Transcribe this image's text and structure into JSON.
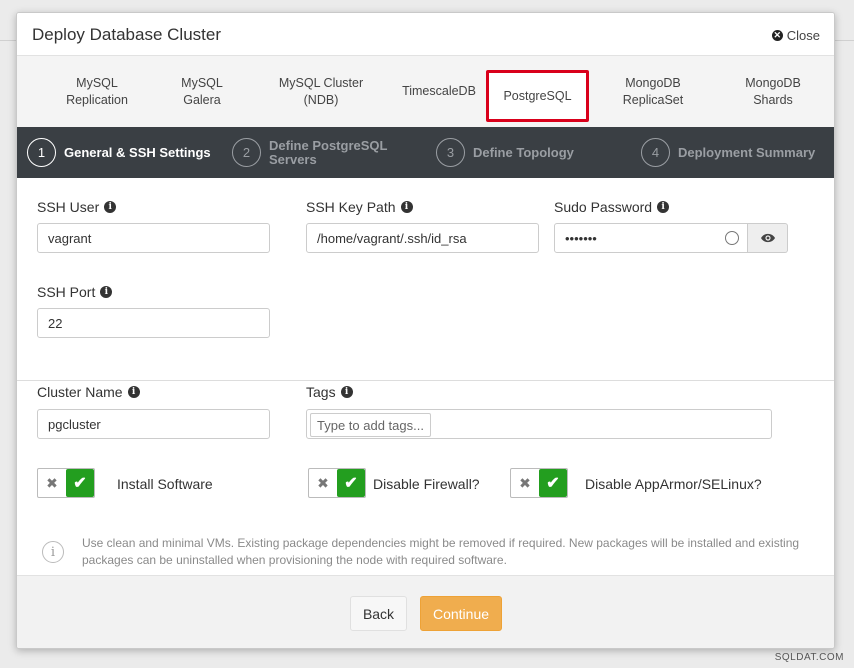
{
  "modal": {
    "title": "Deploy Database Cluster",
    "close_label": "Close"
  },
  "tabs": [
    {
      "line1": "MySQL",
      "line2": "Replication"
    },
    {
      "line1": "MySQL",
      "line2": "Galera"
    },
    {
      "line1": "MySQL Cluster",
      "line2": "(NDB)"
    },
    {
      "line1": "TimescaleDB",
      "line2": ""
    },
    {
      "line1": "PostgreSQL",
      "line2": ""
    },
    {
      "line1": "MongoDB",
      "line2": "ReplicaSet"
    },
    {
      "line1": "MongoDB",
      "line2": "Shards"
    }
  ],
  "active_tab": "PostgreSQL",
  "steps": [
    {
      "num": "1",
      "label1": "General & SSH Settings",
      "label2": ""
    },
    {
      "num": "2",
      "label1": "Define PostgreSQL",
      "label2": "Servers"
    },
    {
      "num": "3",
      "label1": "Define Topology",
      "label2": ""
    },
    {
      "num": "4",
      "label1": "Deployment Summary",
      "label2": ""
    }
  ],
  "form": {
    "ssh_user": {
      "label": "SSH User",
      "value": "vagrant"
    },
    "ssh_key_path": {
      "label": "SSH Key Path",
      "value": "/home/vagrant/.ssh/id_rsa"
    },
    "sudo_password": {
      "label": "Sudo Password",
      "value": "•••••••"
    },
    "ssh_port": {
      "label": "SSH Port",
      "value": "22"
    },
    "cluster_name": {
      "label": "Cluster Name",
      "value": "pgcluster"
    },
    "tags": {
      "label": "Tags",
      "placeholder": "Type to add tags..."
    }
  },
  "toggles": {
    "install_software": {
      "label": "Install Software",
      "on": true
    },
    "disable_firewall": {
      "label": "Disable Firewall?",
      "on": true
    },
    "disable_apparmor": {
      "label": "Disable AppArmor/SELinux?",
      "on": true
    }
  },
  "note": "Use clean and minimal VMs. Existing package dependencies might be removed if required. New packages will be installed and existing packages can be uninstalled when provisioning the node with required software.",
  "footer": {
    "back_label": "Back",
    "continue_label": "Continue"
  },
  "watermark": "SQLDAT.COM",
  "colors": {
    "accent_continue": "#f0ad4e",
    "toggle_on": "#239e1f",
    "active_tab_border": "#d9001b",
    "stepbar_bg": "#3a3f44"
  }
}
